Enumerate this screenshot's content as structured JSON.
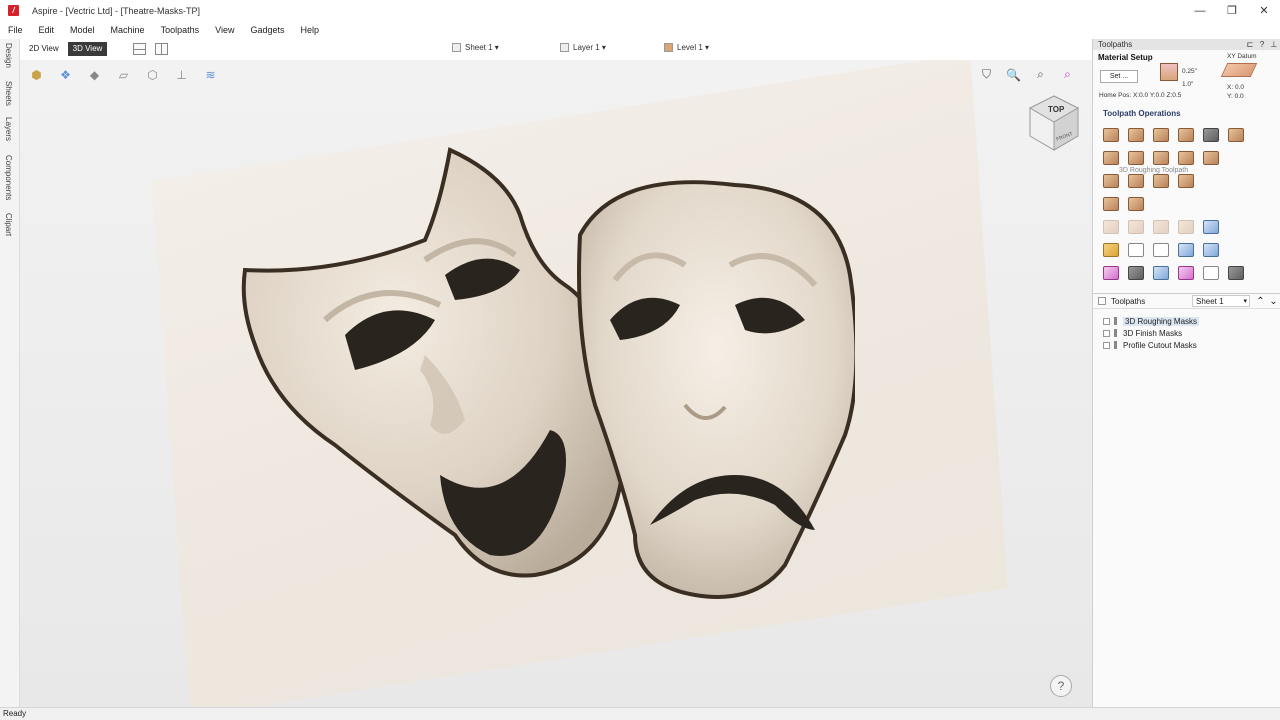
{
  "window": {
    "title": "Aspire - [Vectric Ltd] - [Theatre-Masks-TP]",
    "logo_letter": "/",
    "minimize": "—",
    "restore": "❐",
    "close": "✕"
  },
  "menu": [
    "File",
    "Edit",
    "Model",
    "Machine",
    "Toolpaths",
    "View",
    "Gadgets",
    "Help"
  ],
  "left_tabs": [
    "Design",
    "Sheets",
    "Layers",
    "Components",
    "Clipart"
  ],
  "view_toolbar": {
    "view_2d": "2D View",
    "view_3d": "3D View",
    "sheet": "Sheet 1",
    "layer": "Layer 1",
    "level": "Level 1"
  },
  "viewport": {
    "cube_top": "TOP",
    "cube_front": "FRONT",
    "help": "?"
  },
  "panel": {
    "header": "Toolpaths",
    "material_setup": "Material Setup",
    "set_button": "Set ...",
    "home_pos": "Home Pos:  X:0.0 Y:0.0 Z:0.5",
    "thickness_top": "0.25\"",
    "thickness": "1.0\"",
    "xy_datum": "XY Datum",
    "xy_x": "X: 0.0",
    "xy_y": "Y: 0.0",
    "operations_title": "Toolpath Operations",
    "tooltip": "3D Roughing Toolpath",
    "toolpaths_label": "Toolpaths",
    "sheet_select": "Sheet 1",
    "toolpaths": [
      {
        "name": "3D Roughing Masks"
      },
      {
        "name": "3D Finish Masks"
      },
      {
        "name": "Profile Cutout Masks"
      }
    ]
  },
  "status": "Ready"
}
